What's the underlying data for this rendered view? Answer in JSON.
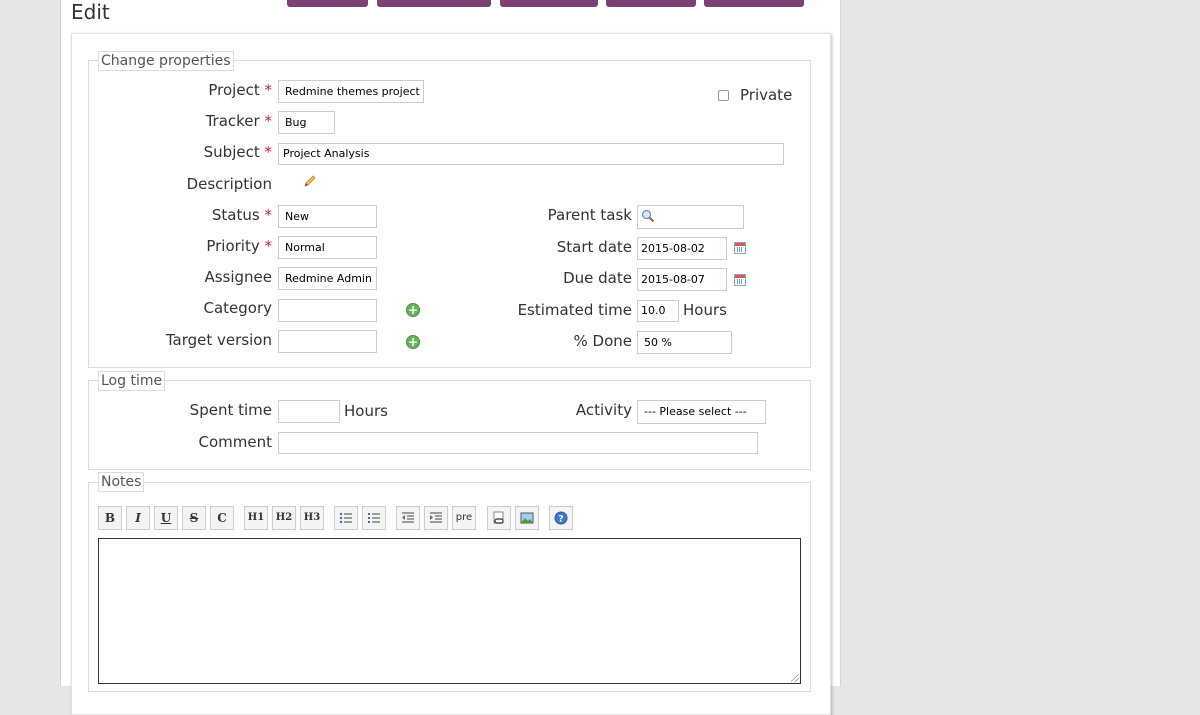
{
  "page": {
    "title": "Edit"
  },
  "sections": {
    "change_properties": "Change properties",
    "log_time": "Log time",
    "notes": "Notes"
  },
  "form": {
    "project": {
      "label": "Project",
      "value": "Redmine themes project"
    },
    "private": {
      "label": "Private",
      "checked": false
    },
    "tracker": {
      "label": "Tracker",
      "value": "Bug"
    },
    "subject": {
      "label": "Subject",
      "value": "Project Analysis"
    },
    "description": {
      "label": "Description"
    },
    "status": {
      "label": "Status",
      "value": "New"
    },
    "priority": {
      "label": "Priority",
      "value": "Normal"
    },
    "assignee": {
      "label": "Assignee",
      "value": "Redmine Admin"
    },
    "category": {
      "label": "Category",
      "value": ""
    },
    "target_version": {
      "label": "Target version",
      "value": ""
    },
    "parent_task": {
      "label": "Parent task",
      "value": ""
    },
    "start_date": {
      "label": "Start date",
      "value": "2015-08-02"
    },
    "due_date": {
      "label": "Due date",
      "value": "2015-08-07"
    },
    "estimated_time": {
      "label": "Estimated time",
      "value": "10.0",
      "unit": "Hours"
    },
    "done": {
      "label": "% Done",
      "value": "50 %"
    }
  },
  "log_time": {
    "spent_time": {
      "label": "Spent time",
      "value": "",
      "unit": "Hours"
    },
    "activity": {
      "label": "Activity",
      "value": "--- Please select ---"
    },
    "comment": {
      "label": "Comment",
      "value": ""
    }
  },
  "required_marker": "*",
  "toolbar": {
    "bold": "B",
    "italic": "I",
    "underline": "U",
    "strike": "S",
    "code": "C",
    "h1": "H1",
    "h2": "H2",
    "h3": "H3",
    "pre": "pre"
  },
  "colors": {
    "accent": "#7e3f79",
    "required": "#c1272d"
  }
}
